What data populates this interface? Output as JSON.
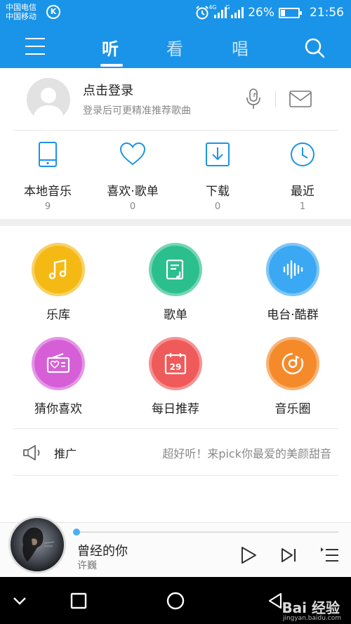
{
  "status_bar": {
    "carrier_1": "中国电信",
    "carrier_2": "中国移动",
    "app_badge": "K",
    "net_1": "4G",
    "net_2": "G",
    "battery_level": 0.26,
    "battery_text": "26%",
    "time": "21:56"
  },
  "top_nav": {
    "tabs": [
      {
        "label": "听",
        "active": true
      },
      {
        "label": "看",
        "active": false
      },
      {
        "label": "唱",
        "active": false
      }
    ],
    "accent_color": "#1a94e8"
  },
  "login": {
    "title": "点击登录",
    "subtitle": "登录后可更精准推荐歌曲"
  },
  "stats": [
    {
      "label": "本地音乐",
      "count": "9",
      "icon": "phone-icon"
    },
    {
      "label": "喜欢·歌单",
      "count": "0",
      "icon": "heart-icon"
    },
    {
      "label": "下载",
      "count": "0",
      "icon": "download-icon"
    },
    {
      "label": "最近",
      "count": "1",
      "icon": "clock-icon"
    }
  ],
  "features": [
    {
      "label": "乐库",
      "color": "#f5b914",
      "icon": "music-note-icon"
    },
    {
      "label": "歌单",
      "color": "#2bbf8e",
      "icon": "playlist-icon"
    },
    {
      "label": "电台·酷群",
      "color": "#3aa8f3",
      "icon": "sound-wave-icon"
    },
    {
      "label": "猜你喜欢",
      "color": "#d65fd8",
      "icon": "radio-heart-icon"
    },
    {
      "label": "每日推荐",
      "color": "#ef5a5a",
      "icon": "calendar-icon",
      "day": "29"
    },
    {
      "label": "音乐圈",
      "color": "#f58a2b",
      "icon": "music-disc-icon"
    }
  ],
  "promo": {
    "tag": "推广",
    "text": "超好听！来pick你最爱的美颜甜音"
  },
  "player": {
    "song": "曾经的你",
    "artist": "许巍",
    "progress": 0.0
  },
  "watermark": {
    "text": "Bai 经验",
    "sub": "jingyan.baidu.com"
  }
}
